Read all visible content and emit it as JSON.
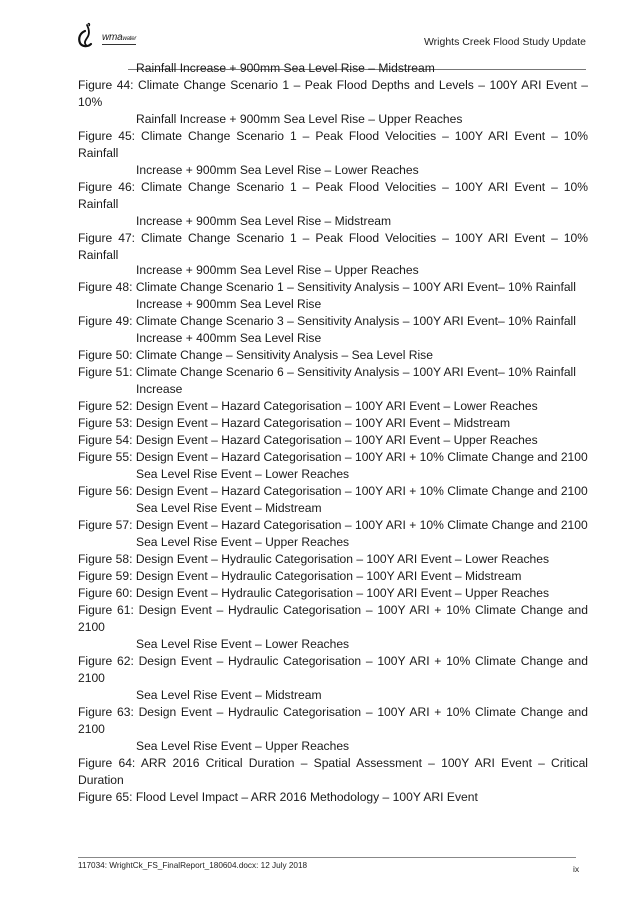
{
  "header": {
    "logo_text_main": "wma",
    "logo_text_small": "water",
    "title": "Wrights Creek Flood Study Update"
  },
  "figures": [
    {
      "label": "",
      "first": "",
      "cont": "Rainfall Increase + 900mm Sea Level Rise – Midstream"
    },
    {
      "label": "Figure 44:",
      "first": "Climate Change Scenario 1 – Peak Flood Depths and Levels – 100Y ARI Event – 10%",
      "cont": "Rainfall Increase + 900mm Sea Level Rise – Upper Reaches"
    },
    {
      "label": "Figure 45:",
      "first": "Climate Change Scenario 1 – Peak Flood Velocities – 100Y ARI Event – 10% Rainfall",
      "cont": "Increase + 900mm Sea Level Rise – Lower Reaches"
    },
    {
      "label": "Figure 46:",
      "first": "Climate Change Scenario 1 – Peak Flood Velocities – 100Y ARI Event – 10% Rainfall",
      "cont": "Increase + 900mm Sea Level Rise – Midstream"
    },
    {
      "label": "Figure 47:",
      "first": "Climate Change Scenario 1 – Peak Flood Velocities – 100Y ARI Event – 10% Rainfall",
      "cont": "Increase + 900mm Sea Level Rise – Upper Reaches"
    },
    {
      "label": "Figure 48:",
      "first": "Climate Change Scenario 1 – Sensitivity Analysis – 100Y ARI Event– 10% Rainfall",
      "cont": "Increase + 900mm Sea Level Rise"
    },
    {
      "label": "Figure 49:",
      "first": "Climate Change Scenario 3 – Sensitivity Analysis – 100Y ARI Event– 10% Rainfall",
      "cont": "Increase + 400mm Sea Level Rise"
    },
    {
      "label": "Figure 50:",
      "first": "Climate Change – Sensitivity Analysis – Sea Level Rise",
      "cont": ""
    },
    {
      "label": "Figure 51:",
      "first": "Climate Change Scenario 6 – Sensitivity Analysis – 100Y ARI Event– 10% Rainfall",
      "cont": "Increase"
    },
    {
      "label": "Figure 52:",
      "first": "Design Event – Hazard Categorisation – 100Y ARI Event – Lower Reaches",
      "cont": ""
    },
    {
      "label": "Figure 53:",
      "first": "Design Event – Hazard Categorisation – 100Y ARI Event – Midstream",
      "cont": ""
    },
    {
      "label": "Figure 54:",
      "first": "Design Event – Hazard Categorisation – 100Y ARI Event – Upper Reaches",
      "cont": ""
    },
    {
      "label": "Figure 55:",
      "first": "Design Event – Hazard Categorisation – 100Y ARI + 10% Climate Change and 2100",
      "cont": "Sea Level Rise Event – Lower Reaches"
    },
    {
      "label": "Figure 56:",
      "first": "Design Event – Hazard Categorisation – 100Y ARI + 10% Climate Change and 2100",
      "cont": "Sea Level Rise Event – Midstream"
    },
    {
      "label": "Figure 57:",
      "first": "Design Event – Hazard Categorisation – 100Y ARI + 10% Climate Change and 2100",
      "cont": "Sea Level Rise Event – Upper Reaches"
    },
    {
      "label": "Figure 58:",
      "first": "Design Event – Hydraulic Categorisation – 100Y ARI Event – Lower Reaches",
      "cont": ""
    },
    {
      "label": "Figure 59:",
      "first": "Design Event – Hydraulic Categorisation – 100Y ARI Event – Midstream",
      "cont": ""
    },
    {
      "label": "Figure 60:",
      "first": "Design Event – Hydraulic Categorisation – 100Y ARI Event – Upper Reaches",
      "cont": ""
    },
    {
      "label": "Figure 61:",
      "first": "Design Event – Hydraulic Categorisation – 100Y ARI + 10% Climate Change and 2100",
      "cont": "Sea Level Rise Event – Lower Reaches"
    },
    {
      "label": "Figure 62:",
      "first": "Design Event – Hydraulic Categorisation – 100Y ARI + 10% Climate Change and 2100",
      "cont": "Sea Level Rise Event – Midstream"
    },
    {
      "label": "Figure 63:",
      "first": "Design Event – Hydraulic Categorisation – 100Y ARI + 10% Climate Change and 2100",
      "cont": "Sea Level Rise Event – Upper Reaches"
    },
    {
      "label": "Figure 64:",
      "first": "ARR 2016 Critical Duration – Spatial Assessment – 100Y ARI Event – Critical Duration",
      "cont": ""
    },
    {
      "label": "Figure 65:",
      "first": "Flood Level Impact – ARR 2016 Methodology – 100Y ARI Event",
      "cont": ""
    }
  ],
  "footer": {
    "text": "117034: WrightCk_FS_FinalReport_180604.docx: 12 July 2018",
    "page_number": "ix"
  }
}
